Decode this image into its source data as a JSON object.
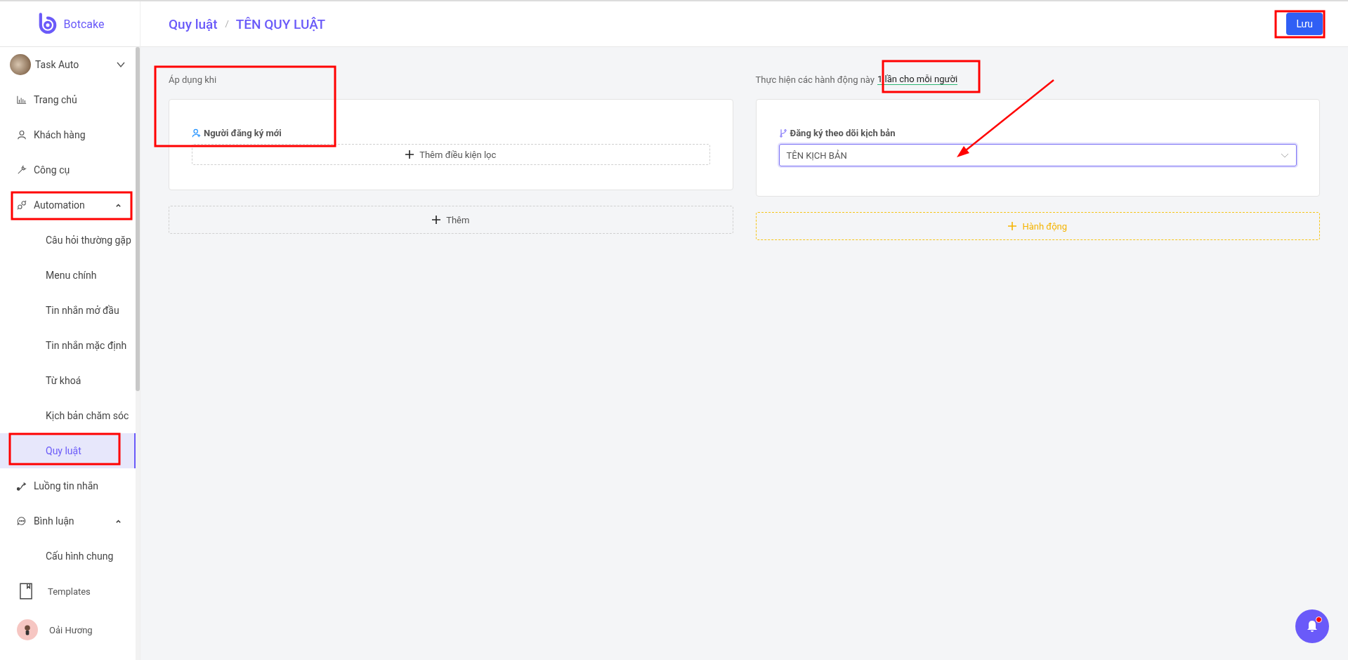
{
  "brand": {
    "name": "Botcake"
  },
  "sidebar": {
    "account": {
      "name": "Task Auto",
      "expanded": false
    },
    "items": [
      {
        "label": "Trang chủ",
        "selected": false
      },
      {
        "label": "Khách hàng",
        "selected": false
      },
      {
        "label": "Công cụ",
        "selected": false
      },
      {
        "label": "Automation",
        "selected": false,
        "expanded": true,
        "children": [
          {
            "label": "Câu hỏi thường gặp",
            "selected": false
          },
          {
            "label": "Menu chính",
            "selected": false
          },
          {
            "label": "Tin nhắn mở đầu",
            "selected": false
          },
          {
            "label": "Tin nhắn mặc định",
            "selected": false
          },
          {
            "label": "Từ khoá",
            "selected": false
          },
          {
            "label": "Kịch bản chăm sóc",
            "selected": false
          },
          {
            "label": "Quy luật",
            "selected": true
          }
        ]
      },
      {
        "label": "Luồng tin nhắn",
        "selected": false
      },
      {
        "label": "Bình luận",
        "selected": false,
        "expanded": true,
        "children": [
          {
            "label": "Cấu hình chung",
            "selected": false
          }
        ]
      }
    ],
    "templates": {
      "label": "Templates"
    },
    "user": {
      "name": "Oải Hương"
    }
  },
  "header": {
    "breadcrumb": [
      "Quy luật",
      "TÊN QUY LUẬT"
    ],
    "save_button": "Lưu"
  },
  "trigger_panel": {
    "label": "Áp dụng khi",
    "trigger": "Người đăng ký mới",
    "filter_button": "Thêm điều kiện lọc",
    "add_button": "Thêm"
  },
  "action_panel": {
    "label": "Thực hiện các hành động này",
    "frequency": "1 lần cho mỗi người",
    "action_title": "Đăng ký theo dõi kịch bản",
    "select_value": "TÊN KỊCH BẢN",
    "add_button": "Hành động"
  },
  "notifications": {
    "unread": true
  }
}
